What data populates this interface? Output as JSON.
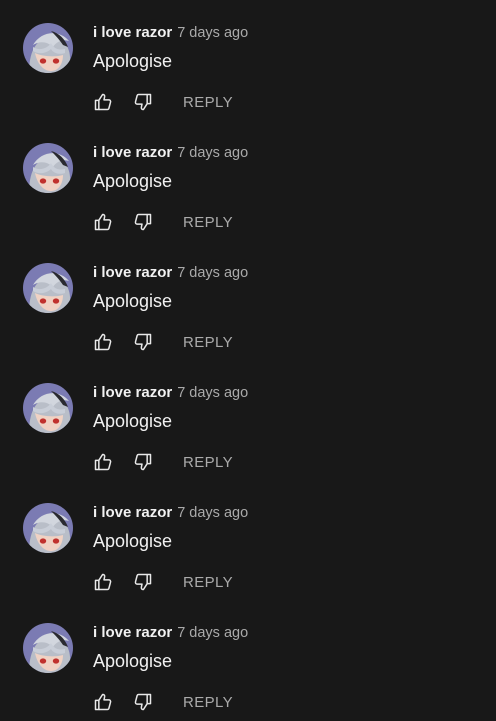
{
  "icons": {
    "avatar": "avatar-image",
    "like": "thumb-up-icon",
    "dislike": "thumb-down-icon"
  },
  "colors": {
    "background": "#181818",
    "author_text": "#f1f1f1",
    "secondary_text": "#aaaaaa",
    "avatar_bg": "#7b7bb3"
  },
  "comments": [
    {
      "author": "i love razor",
      "time": "7 days ago",
      "text": "Apologise",
      "reply_label": "REPLY"
    },
    {
      "author": "i love razor",
      "time": "7 days ago",
      "text": "Apologise",
      "reply_label": "REPLY"
    },
    {
      "author": "i love razor",
      "time": "7 days ago",
      "text": "Apologise",
      "reply_label": "REPLY"
    },
    {
      "author": "i love razor",
      "time": "7 days ago",
      "text": "Apologise",
      "reply_label": "REPLY"
    },
    {
      "author": "i love razor",
      "time": "7 days ago",
      "text": "Apologise",
      "reply_label": "REPLY"
    },
    {
      "author": "i love razor",
      "time": "7 days ago",
      "text": "Apologise",
      "reply_label": "REPLY"
    }
  ]
}
